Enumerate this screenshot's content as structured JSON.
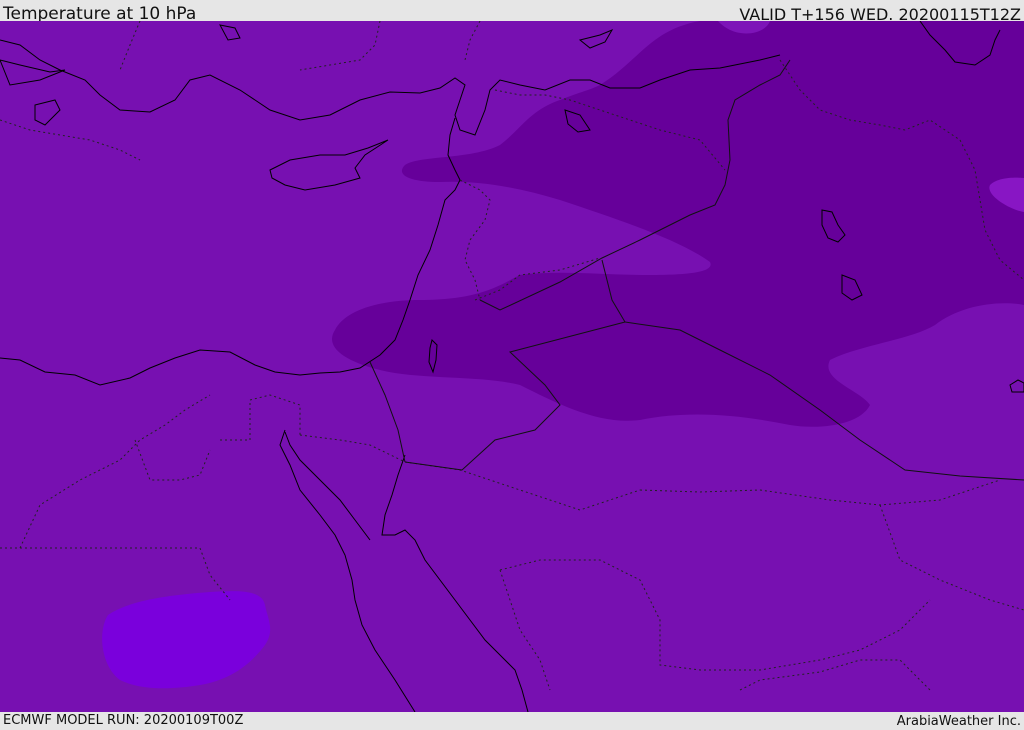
{
  "header": {
    "title": "Temperature at 10 hPa",
    "valid_time": "VALID T+156 WED. 20200115T12Z"
  },
  "footer": {
    "model_run": "ECMWF MODEL RUN: 20200109T00Z",
    "credit": "ArabiaWeather Inc."
  },
  "map": {
    "colors": {
      "base_fill": "#7710b1",
      "dark_band": "#66009a",
      "light_patch": "#8816c4",
      "cold_blob": "#7a00dc",
      "coastline": "#000000",
      "border": "#222222"
    }
  }
}
